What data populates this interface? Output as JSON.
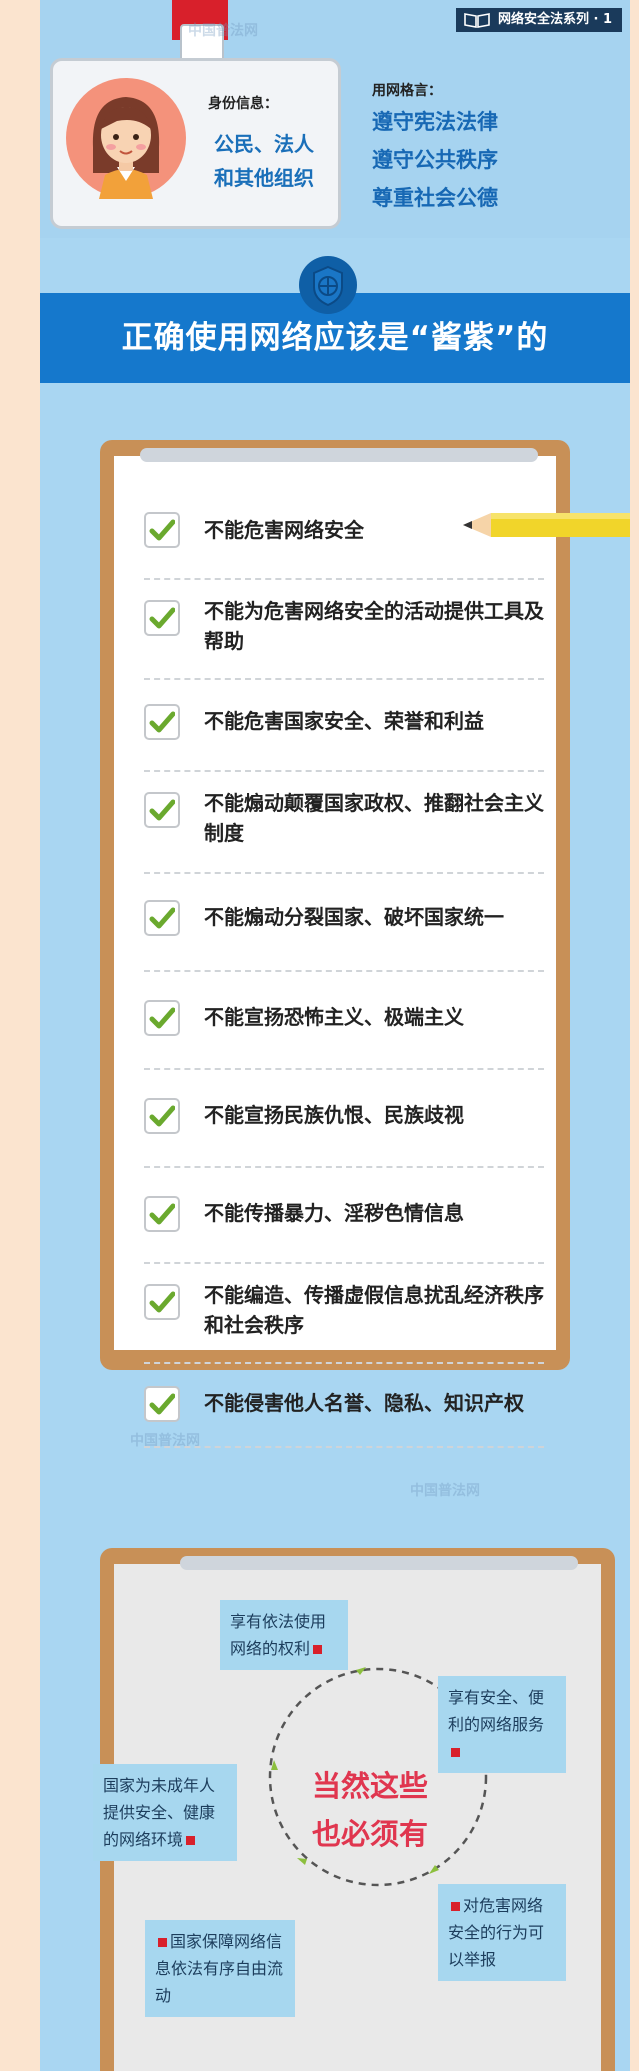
{
  "header": {
    "series_tag": "网络安全法系列 · 1",
    "id_label": "身份信息：",
    "id_value_line1": "公民、法人",
    "id_value_line2": "和其他组织",
    "motto_label": "用网格言：",
    "motto": [
      "遵守宪法法律",
      "遵守公共秩序",
      "尊重社会公德"
    ]
  },
  "banner": {
    "title": "正确使用网络应该是“酱紫”的"
  },
  "checklist": {
    "items": [
      {
        "text": "不能危害网络安全"
      },
      {
        "text": "不能为危害网络安全的活动提供工具及帮助"
      },
      {
        "text": "不能危害国家安全、荣誉和利益"
      },
      {
        "text": "不能煽动颠覆国家政权、推翻社会主义制度"
      },
      {
        "text": "不能煽动分裂国家、破坏国家统一"
      },
      {
        "text": "不能宣扬恐怖主义、极端主义"
      },
      {
        "text": "不能宣扬民族仇恨、民族歧视"
      },
      {
        "text": "不能传播暴力、淫秽色情信息"
      },
      {
        "text": "不能编造、传播虚假信息扰乱经济秩序和社会秩序"
      },
      {
        "text": "不能侵害他人名誉、隐私、知识产权"
      }
    ]
  },
  "rights": {
    "center_line1": "当然这些",
    "center_line2": "也必须有",
    "bubbles": {
      "top": "享有依法使用网络的权利",
      "right_top": "享有安全、便利的网络服务",
      "left": "国家为未成年人提供安全、健康的网络环境",
      "right_bottom": "对危害网络安全的行为可以举报",
      "bottom": "国家保障网络信息依法有序自由流动"
    }
  },
  "colors": {
    "page_bg": "#a9d6f2",
    "banner_bg": "#1578cc",
    "board": "#c89057",
    "accent_red": "#e0364f",
    "check_green": "#6aa92e"
  },
  "watermark": "中国普法网"
}
